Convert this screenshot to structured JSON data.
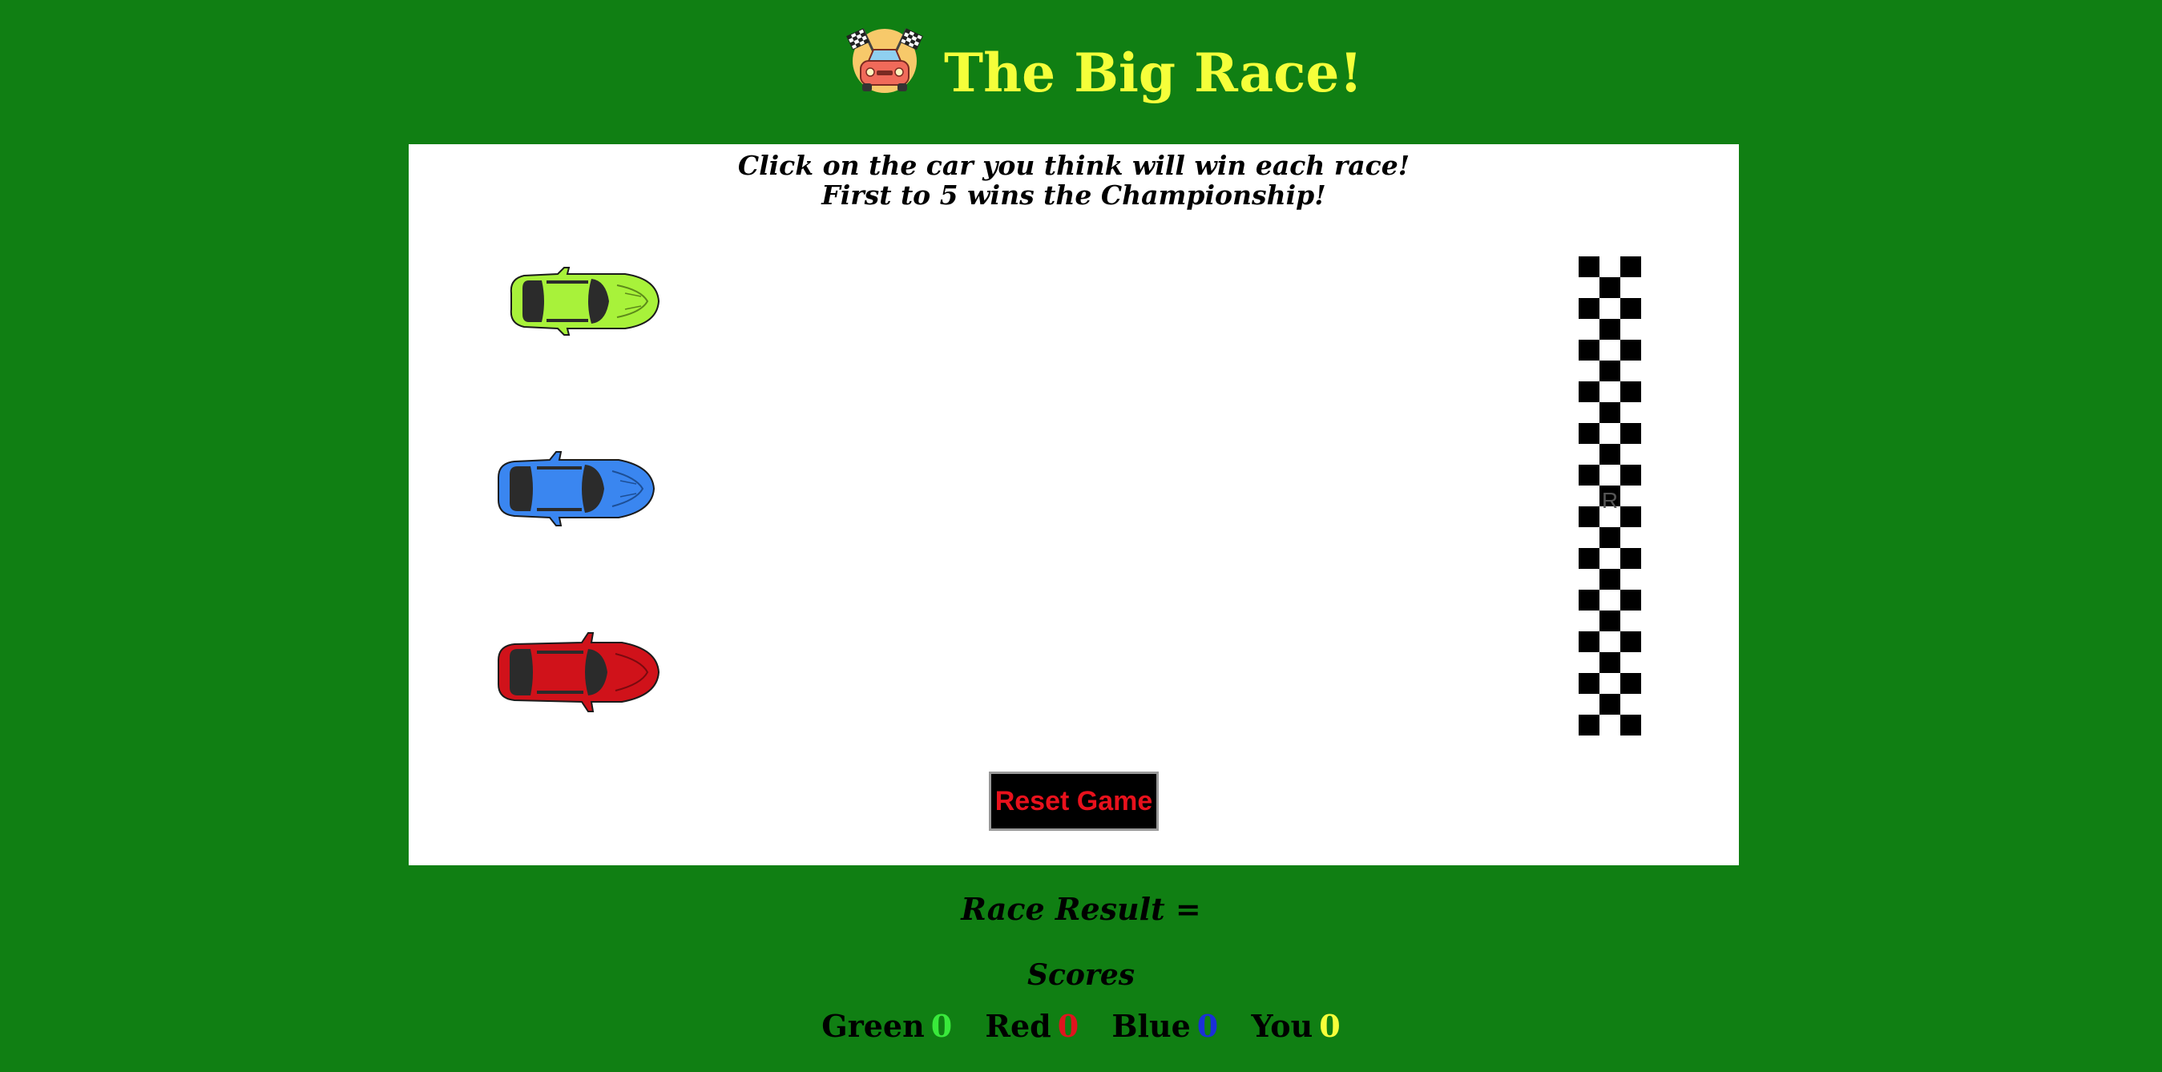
{
  "header": {
    "title": "The Big Race!",
    "logo_icon": "race-car-checkered-flags-icon"
  },
  "instructions": {
    "line1": "Click on the car you think will win each race!",
    "line2": "First to 5 wins the Championship!"
  },
  "cars": [
    {
      "name": "green",
      "color": "#a8f23a",
      "icon": "green-car-icon"
    },
    {
      "name": "blue",
      "color": "#3a86f0",
      "icon": "blue-car-icon"
    },
    {
      "name": "red",
      "color": "#d0121a",
      "icon": "red-car-icon"
    }
  ],
  "finish_line": {
    "icon": "checkered-finish-line-icon",
    "label": "R"
  },
  "controls": {
    "reset_label": "Reset Game"
  },
  "result": {
    "label": "Race Result ="
  },
  "scores": {
    "title": "Scores",
    "items": [
      {
        "label": "Green",
        "value": "0",
        "color": "#39e93b"
      },
      {
        "label": "Red",
        "value": "0",
        "color": "#e0141e"
      },
      {
        "label": "Blue",
        "value": "0",
        "color": "#1a2fd8"
      },
      {
        "label": "You",
        "value": "0",
        "color": "#f5ff3a"
      }
    ]
  },
  "colors": {
    "background": "#107f13",
    "title": "#f5ff3a",
    "button_text": "#e8111c"
  }
}
